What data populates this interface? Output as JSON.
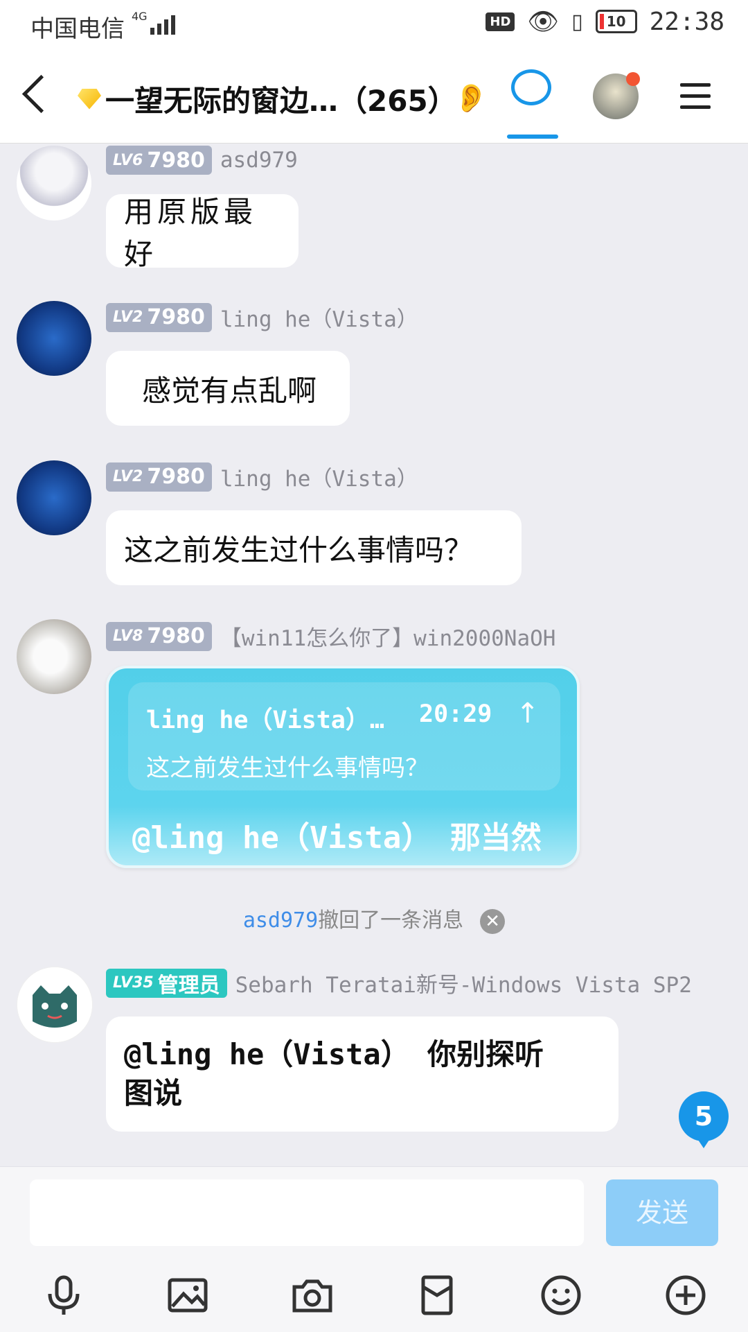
{
  "status_bar": {
    "carrier": "中国电信",
    "network": "4G",
    "hd_label": "HD",
    "battery": "10",
    "time": "22:38"
  },
  "header": {
    "title": "一望无际的窗边…（265）"
  },
  "messages": [
    {
      "level": "LV6",
      "points": "7980",
      "nickname": "asd979",
      "text": "用原版最好"
    },
    {
      "level": "LV2",
      "points": "7980",
      "nickname": "ling he（Vista）",
      "text": "感觉有点乱啊"
    },
    {
      "level": "LV2",
      "points": "7980",
      "nickname": "ling he（Vista）",
      "text": "这之前发生过什么事情吗？"
    },
    {
      "level": "LV8",
      "points": "7980",
      "nickname": "【win11怎么你了】win2000NaOH",
      "quote_sender": "ling he（Vista）…",
      "quote_time": "20:29",
      "quote_text": "这之前发生过什么事情吗？",
      "text": "@ling he（Vista） 那当然"
    },
    {
      "level": "LV35",
      "role": "管理员",
      "nickname": "Sebarh Teratai新号-Windows Vista SP2",
      "text": "@ling he（Vista） 你别探听图说"
    }
  ],
  "recall_notice": {
    "user": "asd979",
    "text": "撤回了一条消息"
  },
  "unread_count": "5",
  "input": {
    "placeholder": "",
    "send_label": "发送"
  },
  "toolbar_icons": [
    "microphone-icon",
    "image-icon",
    "camera-icon",
    "red-packet-icon",
    "emoji-icon",
    "plus-icon"
  ],
  "colors": {
    "accent": "#1896e8",
    "special_bubble": "#5dd4ee",
    "admin_badge": "#2cc7c0",
    "level_badge": "#a9b0c3"
  }
}
